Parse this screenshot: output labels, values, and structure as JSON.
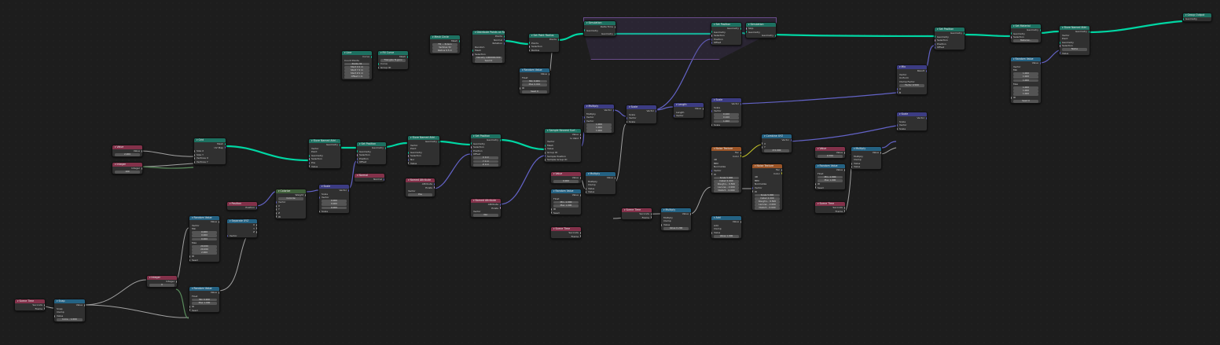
{
  "nodes": {
    "scene_time_a": {
      "title": "Scene Time",
      "rows": [
        "Seconds",
        "Frame"
      ]
    },
    "snap": {
      "title": "Snap",
      "rows": [
        "Value",
        "Snap",
        "Clamp",
        "Value",
        "Incre... 1.000"
      ]
    },
    "integer_a": {
      "title": "Integer",
      "rows": [
        "Integer",
        "0"
      ]
    },
    "random_value_b": {
      "title": "Random Value",
      "rows": [
        "Value",
        "Float",
        "Min  0.200",
        "Max  1.000",
        "ID",
        "Seed"
      ]
    },
    "random_value_a": {
      "title": "Random Value",
      "rows": [
        "Value",
        "Vector",
        "Min",
        "0.000",
        "0.000",
        "0.000",
        "Max",
        "20.000",
        "20.000",
        "2.000",
        "ID",
        "Seed"
      ]
    },
    "value_a": {
      "title": "Value",
      "rows": [
        "Value",
        "2.000"
      ]
    },
    "integer_b": {
      "title": "Integer",
      "rows": [
        "Integer",
        "100"
      ]
    },
    "grid": {
      "title": "Grid",
      "rows": [
        "Mesh",
        "UV Map",
        "Size X",
        "Size Y",
        "Vertices X",
        "Vertices Y"
      ]
    },
    "position_a": {
      "title": "Position",
      "rows": [
        "Position"
      ]
    },
    "separate_xyz": {
      "title": "Separate XYZ",
      "rows": [
        "X",
        "Y",
        "Z",
        "Vector"
      ]
    },
    "colorize_frame": {
      "title": "Colorize",
      "rows": [
        "Weight",
        "Colorize",
        "Vector",
        "X",
        "Y",
        "Z",
        "W"
      ]
    },
    "store_named_attr_a": {
      "title": "Store Named Attri...",
      "rows": [
        "Geometry",
        "Vector",
        "Point",
        "Geometry",
        "Selection",
        "Pos",
        "Value"
      ]
    },
    "scale_a": {
      "title": "Scale",
      "rows": [
        "Vector",
        "Scale",
        "Vector",
        "0.000",
        "0.000",
        "0.000",
        "Scale"
      ]
    },
    "set_position_a": {
      "title": "Set Position",
      "rows": [
        "Geometry",
        "Geometry",
        "Selection",
        "Position",
        "Offset"
      ]
    },
    "normal": {
      "title": "Normal",
      "rows": [
        "Normal"
      ]
    },
    "store_named_attr_b": {
      "title": "Store Named Attri...",
      "rows": [
        "Geometry",
        "Vector",
        "Point",
        "Geometry",
        "Selection",
        "Nor",
        "Value"
      ]
    },
    "named_attr_a": {
      "title": "Named Attribute",
      "rows": [
        "Attribute",
        "Exists",
        "Vector",
        "Pos"
      ]
    },
    "set_position_b": {
      "title": "Set Position",
      "rows": [
        "Geometry",
        "Geometry",
        "Selection",
        "Position",
        "Offset",
        "X  0 m",
        "Y  0 m",
        "Z  0 m"
      ]
    },
    "named_attr_b": {
      "title": "Named Attribute",
      "rows": [
        "Attribute",
        "Exists",
        "Vector",
        "Nor"
      ]
    },
    "sample_nearest": {
      "title": "Sample Nearest Surf...",
      "rows": [
        "Value",
        "Is Valid",
        "Vector",
        "Mesh",
        "Value",
        "Group ID",
        "Sample Position",
        "Sample Group ID"
      ]
    },
    "value_b": {
      "title": "Value",
      "rows": [
        "Value",
        "0.000"
      ]
    },
    "random_value_c": {
      "title": "Random Value",
      "rows": [
        "Value",
        "Float",
        "Min  -1.000",
        "Max  1.000",
        "ID",
        "Seed"
      ]
    },
    "scene_time_b": {
      "title": "Scene Time",
      "rows": [
        "Seconds",
        "Frame"
      ]
    },
    "multiply_a": {
      "title": "Multiply",
      "rows": [
        "Vector",
        "Multiply",
        "Vector",
        "Vector",
        "1.000",
        "1.000",
        "1.000"
      ]
    },
    "multiply_b": {
      "title": "Multiply",
      "rows": [
        "Value",
        "Multiply",
        "Clamp",
        "Value",
        "Value"
      ]
    },
    "scale_b": {
      "title": "Scale",
      "rows": [
        "Vector",
        "Scale",
        "Vector",
        "Scale"
      ]
    },
    "length": {
      "title": "Length",
      "rows": [
        "Value",
        "Length",
        "Vector"
      ]
    },
    "scale_c": {
      "title": "Scale",
      "rows": [
        "Vector",
        "Scale",
        "Vector",
        "0.100",
        "0.100",
        "1.000",
        "Scale"
      ]
    },
    "scene_time_c": {
      "title": "Scene Time",
      "rows": [
        "Seconds",
        "Frame"
      ]
    },
    "multiply_c": {
      "title": "Multiply",
      "rows": [
        "Value",
        "Multiply",
        "Clamp",
        "Value",
        "Value  0.200"
      ]
    },
    "noise_tex_a": {
      "title": "Noise Texture",
      "rows": [
        "Fac",
        "Color",
        "4D",
        "fBM",
        "Normalize",
        "Vector",
        "W",
        "Scale  5.000",
        "Detail  2.000",
        "Roughn... 0.500",
        "Lacuna... 2.000",
        "Distort... 0.000"
      ]
    },
    "noise_tex_b": {
      "title": "Noise Texture",
      "rows": [
        "Fac",
        "Color",
        "4D",
        "fBM",
        "Normalize",
        "Vector",
        "W",
        "Scale  5.000",
        "Detail  2.000",
        "Roughn... 0.500",
        "Lacuna... 2.000",
        "Distort... 0.000"
      ]
    },
    "add": {
      "title": "Add",
      "rows": [
        "Value",
        "Add",
        "Clamp",
        "Value",
        "Value  1.000"
      ]
    },
    "combine_xyz": {
      "title": "Combine XYZ",
      "rows": [
        "Vector",
        "X",
        "Y",
        "Z  0.000"
      ]
    },
    "value_c": {
      "title": "Value",
      "rows": [
        "Value",
        "0.700"
      ]
    },
    "random_value_d": {
      "title": "Random Value",
      "rows": [
        "Value",
        "Float",
        "Min  -1.000",
        "Max  1.000",
        "ID",
        "Seed"
      ]
    },
    "scene_time_d": {
      "title": "Scene Time",
      "rows": [
        "Seconds",
        "Frame"
      ]
    },
    "multiply_d": {
      "title": "Multiply",
      "rows": [
        "Value",
        "Multiply",
        "Clamp",
        "Value",
        "Value"
      ]
    },
    "scale_d": {
      "title": "Scale",
      "rows": [
        "Vector",
        "Scale",
        "Vector",
        "Scale"
      ]
    },
    "mix": {
      "title": "Mix",
      "rows": [
        "Result",
        "Vector",
        "Uniform",
        "Clamp Factor",
        "Factor  0.500",
        "A",
        "B"
      ]
    },
    "line": {
      "title": "Line",
      "rows": [
        "Curve",
        "Count Points",
        "Points  32",
        "Start X  0 m",
        "Start Y  0 m",
        "Start Z  0 m",
        "Offset  1 m"
      ]
    },
    "fill_curve": {
      "title": "Fill Curve",
      "rows": [
        "Mesh",
        "Triangles  N-gons",
        "Curve",
        "Group ID"
      ]
    },
    "mesh_circle": {
      "title": "Mesh Circle",
      "rows": [
        "Mesh",
        "Fill ...  N-Gon",
        "Vertices  32",
        "Radius  0.5 m"
      ]
    },
    "distribute_points": {
      "title": "Distribute Points on Fa...",
      "rows": [
        "Points",
        "Normal",
        "Rotation",
        "Random",
        "Mesh",
        "Selection",
        "Density  1000000.000",
        "Seed  0"
      ]
    },
    "set_point_radius": {
      "title": "Set Point Radius",
      "rows": [
        "Points",
        "Points",
        "Selection",
        "Radius"
      ]
    },
    "random_value_e": {
      "title": "Random Value",
      "rows": [
        "Value",
        "Float",
        "Min  0.001",
        "Max  0.010",
        "ID",
        "Seed  0"
      ]
    },
    "sim_input": {
      "title": "Simulation",
      "rows": [
        "Delta Time",
        "Geometry",
        "Geometry"
      ]
    },
    "set_position_c": {
      "title": "Set Position",
      "rows": [
        "Geometry",
        "Geometry",
        "Selection",
        "Position",
        "Offset"
      ]
    },
    "sim_output": {
      "title": "Simulation",
      "rows": [
        "Skip",
        "Geometry",
        "Geometry"
      ]
    },
    "set_position_d": {
      "title": "Set Position",
      "rows": [
        "Geometry",
        "Geometry",
        "Selection",
        "Position",
        "Offset"
      ]
    },
    "set_material": {
      "title": "Set Material",
      "rows": [
        "Geometry",
        "Geometry",
        "Selection",
        "Material..."
      ]
    },
    "store_named_attr_c": {
      "title": "Store Named Attri...",
      "rows": [
        "Geometry",
        "Vector",
        "Point",
        "Geometry",
        "Selection",
        "Name",
        "Value"
      ]
    },
    "random_value_f": {
      "title": "Random Value",
      "rows": [
        "Value",
        "Vector",
        "Min",
        "1.000",
        "1.000",
        "1.000",
        "Max",
        "1.000",
        "1.000",
        "1.000",
        "ID",
        "Seed  0"
      ]
    },
    "group_output": {
      "title": "Group Output",
      "rows": [
        "Geometry"
      ]
    }
  }
}
